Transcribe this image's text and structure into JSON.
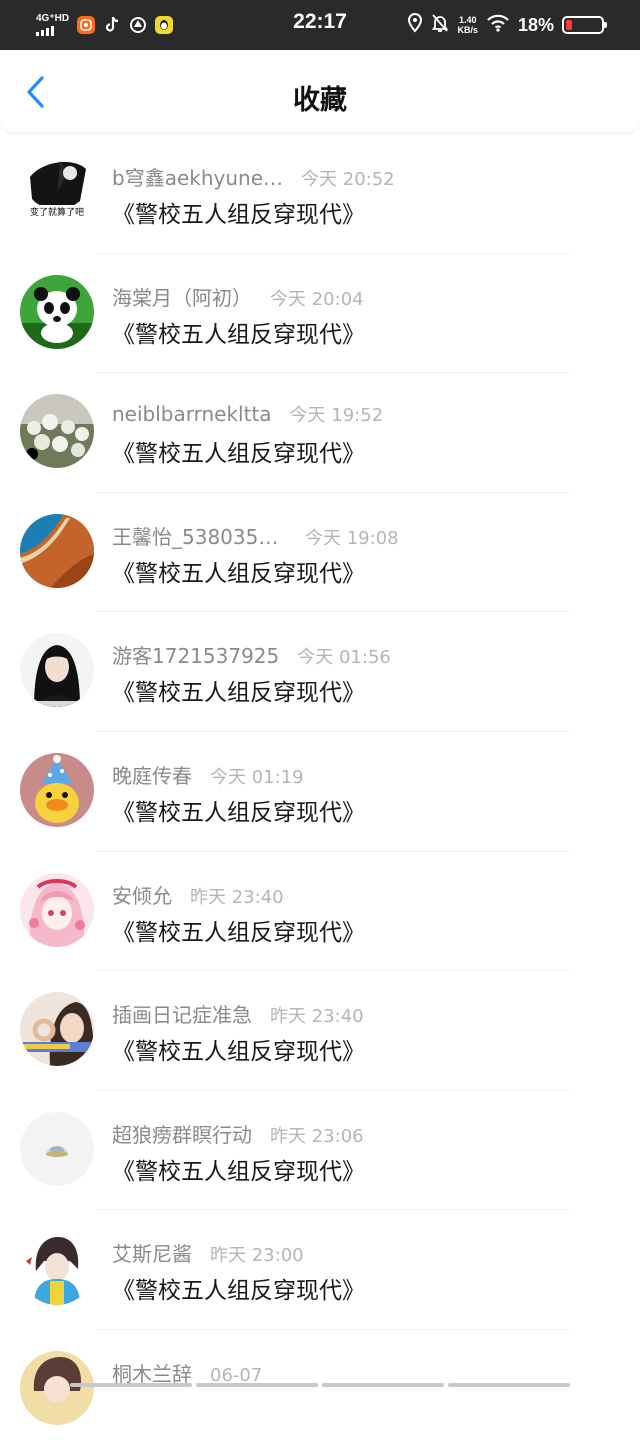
{
  "status_bar": {
    "network": "4G⁺HD",
    "time": "22:17",
    "speed_value": "1.40",
    "speed_unit": "KB/s",
    "battery": "18%",
    "battery_level": 0.18,
    "battery_color": "#ff3b3b",
    "app_icons": [
      "taobao-icon",
      "tiktok-icon",
      "browser-icon",
      "qq-icon"
    ]
  },
  "header": {
    "title": "收藏",
    "back_icon": "chevron-left-icon",
    "accent_color": "#1e90ff"
  },
  "favorites": [
    {
      "author": "b穹鑫aekhyune…",
      "time": "今天 20:52",
      "title": "《警校五人组反穿现代》",
      "avatar_caption": "变了就算了吧"
    },
    {
      "author": "海棠月（阿初）",
      "time": "今天 20:04",
      "title": "《警校五人组反穿现代》"
    },
    {
      "author": "neiblbarrnekltta",
      "time": "今天 19:52",
      "title": "《警校五人组反穿现代》"
    },
    {
      "author": "王馨怡_5380356…",
      "time": "今天 19:08",
      "title": "《警校五人组反穿现代》"
    },
    {
      "author": "游客1721537925",
      "time": "今天 01:56",
      "title": "《警校五人组反穿现代》"
    },
    {
      "author": "晚庭传春",
      "time": "今天 01:19",
      "title": "《警校五人组反穿现代》"
    },
    {
      "author": "安倾允",
      "time": "昨天 23:40",
      "title": "《警校五人组反穿现代》"
    },
    {
      "author": "插画日记症准急",
      "time": "昨天 23:40",
      "title": "《警校五人组反穿现代》"
    },
    {
      "author": "超狼痨群瞑行动",
      "time": "昨天 23:06",
      "title": "《警校五人组反穿现代》"
    },
    {
      "author": "艾斯尼酱",
      "time": "昨天 23:00",
      "title": "《警校五人组反穿现代》"
    },
    {
      "author": "桐木兰辞",
      "time": "06-07",
      "title": ""
    }
  ]
}
